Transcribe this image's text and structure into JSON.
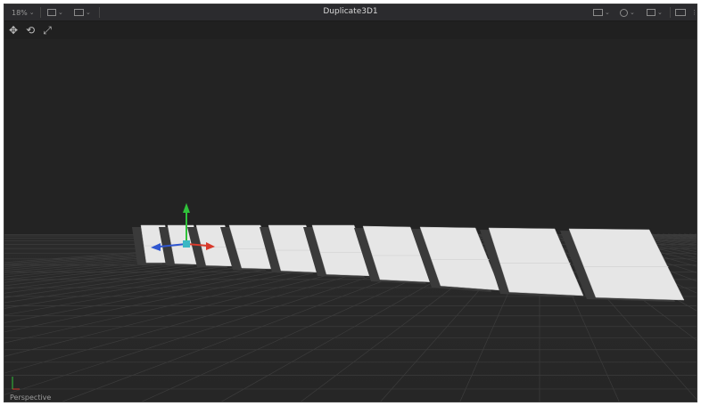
{
  "titlebar": {
    "zoom": "18%",
    "title": "Duplicate3D1"
  },
  "icons": {
    "move": "move-tool-icon",
    "rotate": "rotate-tool-icon",
    "scale": "scale-tool-icon"
  },
  "viewport": {
    "camera_label": "Perspective",
    "axis_y": "Y",
    "axis_x": "X"
  },
  "colors": {
    "background": "#232323",
    "grid": "#3c3c3c",
    "plane": "#e6e6e6",
    "axis_x": "#d83a2c",
    "axis_y": "#2fc23a",
    "axis_z": "#2f56d0"
  }
}
